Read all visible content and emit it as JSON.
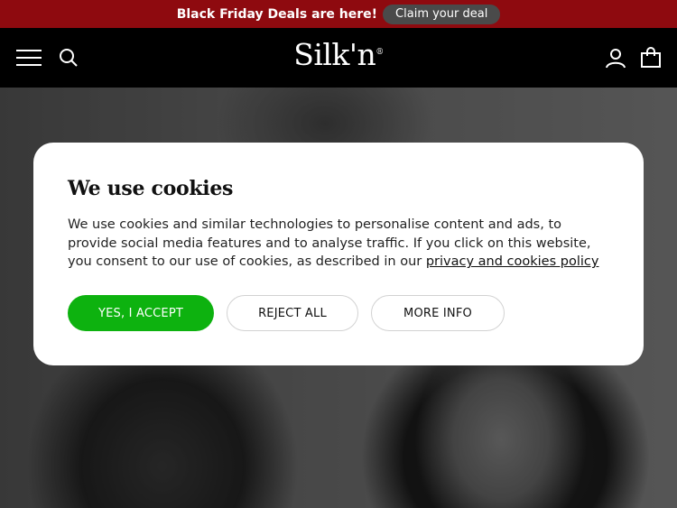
{
  "promo": {
    "text": "Black Friday Deals are here!",
    "button": "Claim your deal"
  },
  "header": {
    "logo": "Silk'n",
    "logo_mark": "®",
    "icons": [
      "menu-icon",
      "search-icon",
      "account-icon",
      "cart-icon"
    ]
  },
  "cookie_modal": {
    "title": "We use cookies",
    "body": "We use cookies and similar technologies to personalise content and ads, to provide social media features and to analyse traffic. If you click on this website, you consent to our use of cookies, as described in our ",
    "link": "privacy and cookies policy",
    "accept": "YES, I ACCEPT",
    "reject": "REJECT ALL",
    "more": "MORE INFO"
  },
  "colors": {
    "promo_bg": "#8e0a0f",
    "header_bg": "#000000",
    "accept_bg": "#0db20f"
  }
}
